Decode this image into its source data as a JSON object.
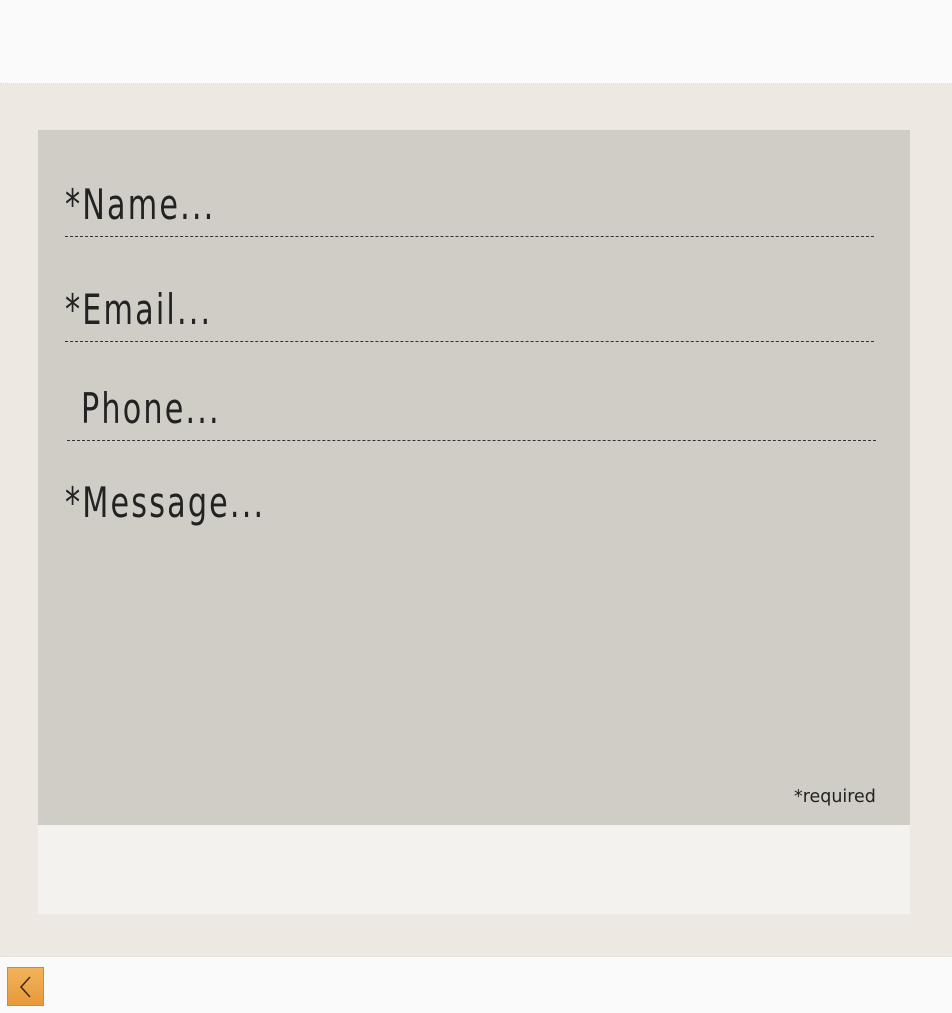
{
  "form": {
    "name_placeholder": "*Name...",
    "email_placeholder": "*Email...",
    "phone_placeholder": "Phone...",
    "message_placeholder": "*Message...",
    "required_note": "*required"
  },
  "icons": {
    "back": "chevron-left-icon"
  },
  "colors": {
    "page_background": "#fafafa",
    "outer_background": "#ede9e2",
    "panel_background": "#d0cdc6",
    "footer_background": "#f4f2ee",
    "back_button": "#f0a94a"
  }
}
